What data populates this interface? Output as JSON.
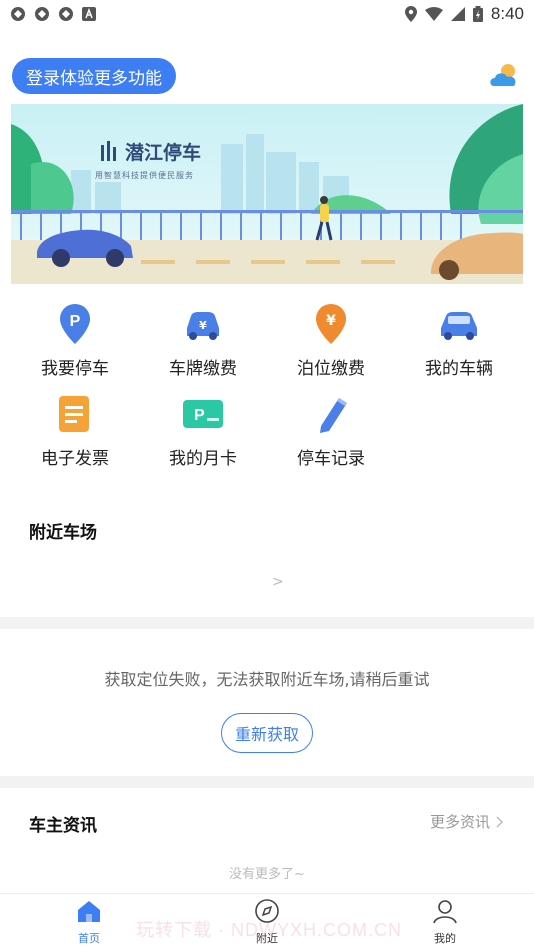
{
  "status_bar": {
    "time": "8:40"
  },
  "header": {
    "login_label": "登录体验更多功能"
  },
  "banner": {
    "brand_name": "潜江停车",
    "brand_tagline": "用智慧科技提供便民服务"
  },
  "services": [
    {
      "label": "我要停车",
      "icon": "parking-pin-icon"
    },
    {
      "label": "车牌缴费",
      "icon": "plate-pay-icon"
    },
    {
      "label": "泊位缴费",
      "icon": "berth-pay-icon"
    },
    {
      "label": "我的车辆",
      "icon": "my-car-icon"
    },
    {
      "label": "电子发票",
      "icon": "invoice-icon"
    },
    {
      "label": "我的月卡",
      "icon": "monthly-card-icon"
    },
    {
      "label": "停车记录",
      "icon": "parking-record-icon"
    }
  ],
  "nearby": {
    "title": "附近车场",
    "chevron": ">",
    "fail_message": "获取定位失败，无法获取附近车场,请稍后重试",
    "retry_label": "重新获取"
  },
  "news": {
    "title": "车主资讯",
    "more_label": "更多资讯",
    "no_more": "没有更多了~"
  },
  "tabbar": {
    "items": [
      {
        "label": "首页"
      },
      {
        "label": "附近"
      },
      {
        "label": "我的"
      }
    ]
  },
  "watermark": "玩转下载 · NDWYXH.COM.CN",
  "colors": {
    "accent": "#3d7ef5",
    "divider": "#f2f2f2"
  }
}
